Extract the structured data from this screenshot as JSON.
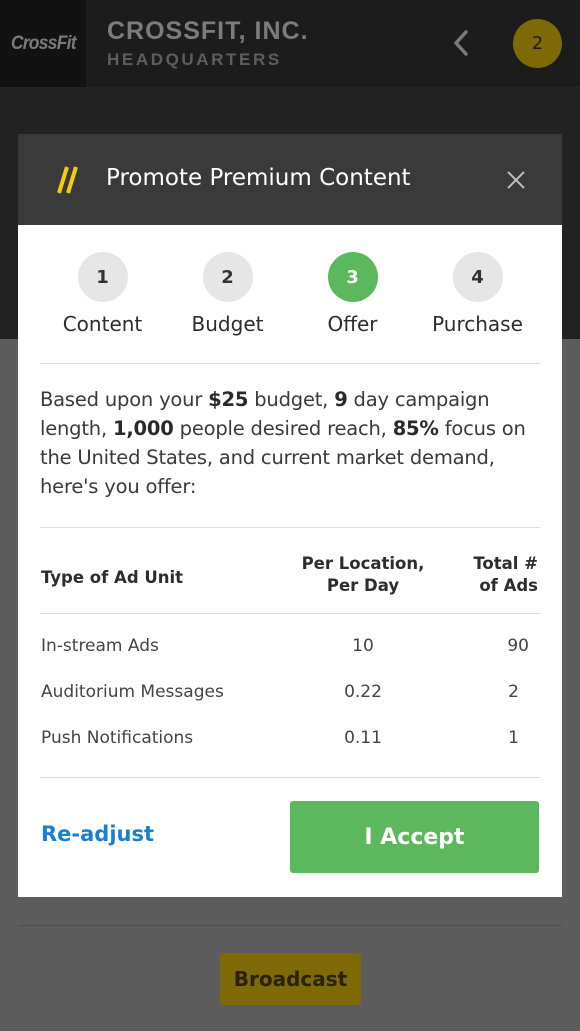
{
  "app": {
    "logo": "CrossFit",
    "title": "CROSSFIT, INC.",
    "subtitle": "HEADQUARTERS",
    "notification_count": "2",
    "broadcast_label": "Broadcast"
  },
  "modal": {
    "title": "Promote Premium Content",
    "icon": "double-slash-icon",
    "steps": [
      {
        "number": "1",
        "label": "Content",
        "active": false
      },
      {
        "number": "2",
        "label": "Budget",
        "active": false
      },
      {
        "number": "3",
        "label": "Offer",
        "active": true
      },
      {
        "number": "4",
        "label": "Purchase",
        "active": false
      }
    ],
    "summary": {
      "p1": "Based upon your ",
      "budget": "$25",
      "p2": " budget, ",
      "days": "9",
      "p3": " day campaign length, ",
      "reach": "1,000",
      "p4": " people desired reach, ",
      "focus": "85%",
      "p5": " focus on the United States, and current market demand, here's you offer:"
    },
    "table": {
      "headers": {
        "type": "Type of Ad Unit",
        "per_location_1": "Per Location,",
        "per_location_2": "Per Day",
        "total_1": "Total #",
        "total_2": "of Ads"
      },
      "rows": [
        {
          "type": "In-stream Ads",
          "per_day": "10",
          "total": "90"
        },
        {
          "type": "Auditorium Messages",
          "per_day": "0.22",
          "total": "2"
        },
        {
          "type": "Push Notifications",
          "per_day": "0.11",
          "total": "1"
        }
      ]
    },
    "readjust_label": "Re-adjust",
    "accept_label": "I Accept"
  },
  "colors": {
    "accent_green": "#5cb85c",
    "link_blue": "#1a7fd2",
    "brand_yellow": "#e6c20b"
  }
}
